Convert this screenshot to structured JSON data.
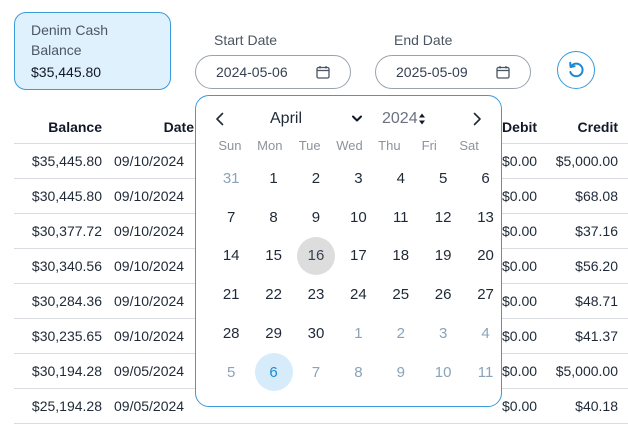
{
  "account": {
    "name": "Denim Cash Balance",
    "balance": "$35,445.80"
  },
  "filters": {
    "start_label": "Start Date",
    "start_value": "2024-05-06",
    "end_label": "End Date",
    "end_value": "2025-05-09",
    "reset_icon": "refresh-icon"
  },
  "table": {
    "headers": {
      "balance": "Balance",
      "date": "Date",
      "debit": "Debit",
      "credit": "Credit"
    },
    "rows": [
      {
        "balance": "$35,445.80",
        "date": "09/10/2024",
        "debit": "$0.00",
        "credit": "$5,000.00"
      },
      {
        "balance": "$30,445.80",
        "date": "09/10/2024",
        "debit": "$0.00",
        "credit": "$68.08"
      },
      {
        "balance": "$30,377.72",
        "date": "09/10/2024",
        "debit": "$0.00",
        "credit": "$37.16"
      },
      {
        "balance": "$30,340.56",
        "date": "09/10/2024",
        "debit": "$0.00",
        "credit": "$56.20"
      },
      {
        "balance": "$30,284.36",
        "date": "09/10/2024",
        "debit": "$0.00",
        "credit": "$48.71"
      },
      {
        "balance": "$30,235.65",
        "date": "09/10/2024",
        "debit": "$0.00",
        "credit": "$41.37"
      },
      {
        "balance": "$30,194.28",
        "date": "09/05/2024",
        "debit": "$0.00",
        "credit": "$5,000.00"
      },
      {
        "balance": "$25,194.28",
        "date": "09/05/2024",
        "debit": "$0.00",
        "credit": "$40.18"
      }
    ]
  },
  "datepicker": {
    "month": "April",
    "year": "2024",
    "weekdays": [
      "Sun",
      "Mon",
      "Tue",
      "Wed",
      "Thu",
      "Fri",
      "Sat"
    ],
    "days": [
      {
        "d": "31",
        "other": true
      },
      {
        "d": "1"
      },
      {
        "d": "2"
      },
      {
        "d": "3"
      },
      {
        "d": "4"
      },
      {
        "d": "5"
      },
      {
        "d": "6"
      },
      {
        "d": "7"
      },
      {
        "d": "8"
      },
      {
        "d": "9"
      },
      {
        "d": "10"
      },
      {
        "d": "11"
      },
      {
        "d": "12"
      },
      {
        "d": "13"
      },
      {
        "d": "14"
      },
      {
        "d": "15"
      },
      {
        "d": "16",
        "today": true
      },
      {
        "d": "17"
      },
      {
        "d": "18"
      },
      {
        "d": "19"
      },
      {
        "d": "20"
      },
      {
        "d": "21"
      },
      {
        "d": "22"
      },
      {
        "d": "23"
      },
      {
        "d": "24"
      },
      {
        "d": "25"
      },
      {
        "d": "26"
      },
      {
        "d": "27"
      },
      {
        "d": "28"
      },
      {
        "d": "29"
      },
      {
        "d": "30"
      },
      {
        "d": "1",
        "other": true
      },
      {
        "d": "2",
        "other": true
      },
      {
        "d": "3",
        "other": true
      },
      {
        "d": "4",
        "other": true
      },
      {
        "d": "5",
        "other": true
      },
      {
        "d": "6",
        "other": true,
        "selected": true
      },
      {
        "d": "7",
        "other": true
      },
      {
        "d": "8",
        "other": true
      },
      {
        "d": "9",
        "other": true
      },
      {
        "d": "10",
        "other": true
      },
      {
        "d": "11",
        "other": true
      }
    ]
  },
  "colors": {
    "accent": "#3b9ad9",
    "card_bg": "#dff1fd",
    "selected_bg": "#d6ecfb",
    "today_bg": "#dddddd"
  }
}
